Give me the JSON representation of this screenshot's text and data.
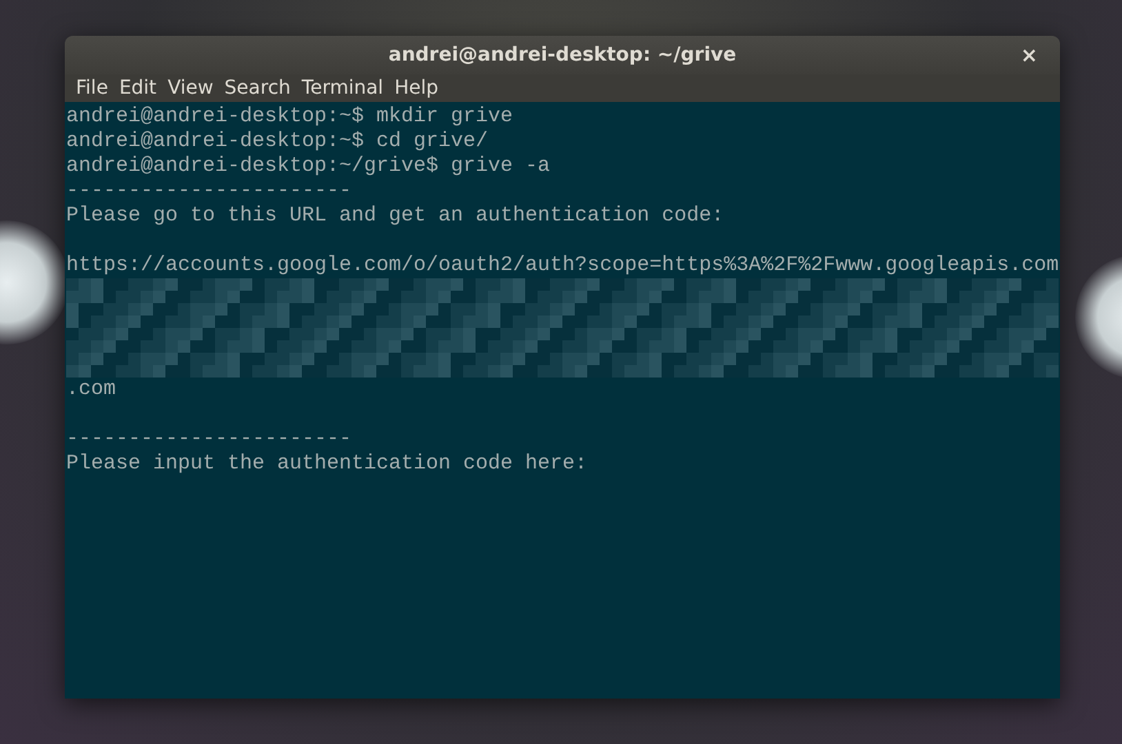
{
  "window": {
    "title": "andrei@andrei-desktop: ~/grive",
    "close": "×"
  },
  "menu": [
    "File",
    "Edit",
    "View",
    "Search",
    "Terminal",
    "Help"
  ],
  "terminal": {
    "lines": [
      {
        "kind": "text",
        "text": "andrei@andrei-desktop:~$ mkdir grive"
      },
      {
        "kind": "text",
        "text": "andrei@andrei-desktop:~$ cd grive/"
      },
      {
        "kind": "text",
        "text": "andrei@andrei-desktop:~/grive$ grive -a"
      },
      {
        "kind": "text",
        "text": "-----------------------"
      },
      {
        "kind": "text",
        "text": "Please go to this URL and get an authentication code:"
      },
      {
        "kind": "blank"
      },
      {
        "kind": "text",
        "text": "https://accounts.google.com/o/oauth2/auth?scope=https%3A%2F%2Fwww.googleapis.com"
      },
      {
        "kind": "redacted"
      },
      {
        "kind": "redacted"
      },
      {
        "kind": "redacted"
      },
      {
        "kind": "redacted"
      },
      {
        "kind": "text",
        "text": ".com"
      },
      {
        "kind": "blank"
      },
      {
        "kind": "text",
        "text": "-----------------------"
      },
      {
        "kind": "text",
        "text": "Please input the authentication code here:"
      }
    ]
  }
}
